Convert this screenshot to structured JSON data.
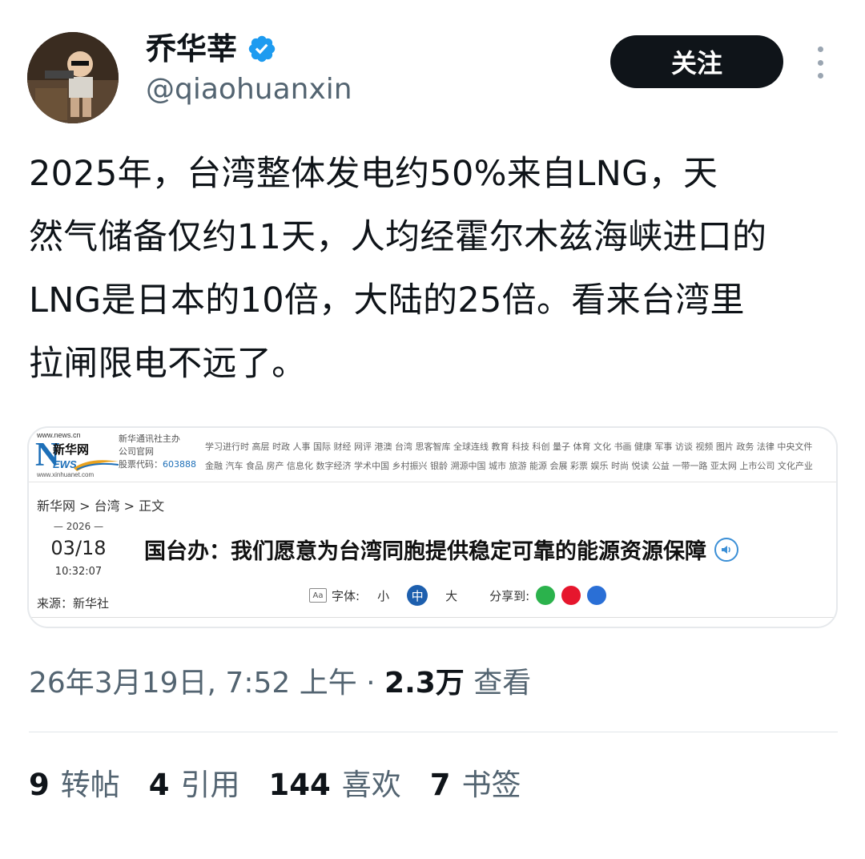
{
  "author": {
    "display_name": "乔华莘",
    "handle": "@qiaohuanxin",
    "verified": true
  },
  "follow_label": "关注",
  "tweet_lines": [
    "2025年，台湾整体发电约50%来自LNG，天",
    "然气储备仅约11天，人均经霍尔木兹海峡进口的",
    "LNG是日本的10倍，大陆的25倍。看来台湾里",
    "拉闸限电不远了。"
  ],
  "card": {
    "site_url": "www.news.cn",
    "site_name": "新华网",
    "site_url2": "www.xinhuanet.com",
    "org_line1": "新华通讯社主办",
    "org_line2": "公司官网",
    "stock_label": "股票代码：",
    "stock_code": "603888",
    "nav_row1": "学习进行时 高层 时政 人事 国际 财经 网评 港澳 台湾 思客智库 全球连线 教育 科技 科创 量子 体育 文化 书画 健康 军事 访谈 视频 图片 政务 法律 中央文件",
    "nav_row2": "金融 汽车 食品 房产 信息化 数字经济 学术中国 乡村振兴 银龄 溯源中国 城市 旅游 能源 会展 彩票 娱乐 时尚 悦读 公益 一带一路 亚太网 上市公司 文化产业",
    "breadcrumb": "新华网 > 台湾 > 正文",
    "date_year": "2026",
    "date_day": "03/18",
    "date_time": "10:32:07",
    "source": "来源：新华社",
    "headline": "国台办：我们愿意为台湾同胞提供稳定可靠的能源资源保障",
    "font_label": "字体:",
    "font_small": "小",
    "font_medium": "中",
    "font_large": "大",
    "share_label": "分享到:"
  },
  "meta": {
    "timestamp": "26年3月19日, 7:52 上午 · ",
    "views_count": "2.3万",
    "views_label": " 查看"
  },
  "stats": {
    "reposts_count": "9",
    "reposts_label": "转帖",
    "quotes_count": "4",
    "quotes_label": "引用",
    "likes_count": "144",
    "likes_label": "喜欢",
    "bookmarks_count": "7",
    "bookmarks_label": "书签"
  },
  "colors": {
    "follow_bg": "#0f1419",
    "muted_text": "#536471",
    "verified_blue": "#1d9bf0",
    "xinhua_blue": "#1d6fb8"
  }
}
